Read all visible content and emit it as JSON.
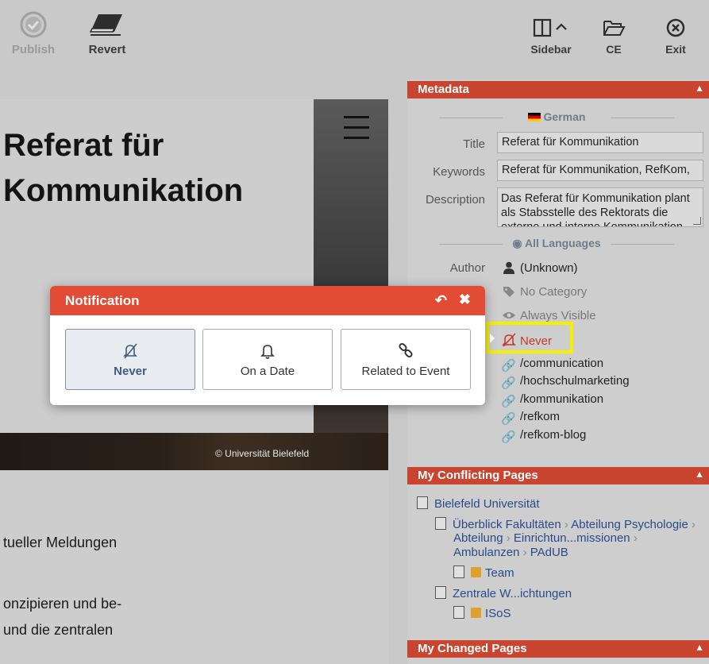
{
  "toolbar": {
    "publish_label": "Publish",
    "revert_label": "Revert",
    "sidebar_label": "Sidebar",
    "ce_label": "CE",
    "exit_label": "Exit"
  },
  "preview": {
    "title_line1": "Referat für",
    "title_line2": "Kommunikation",
    "copyright": "© Universität Bielefeld",
    "text_lines": [
      "tueller Meldungen",
      "onzipieren und be-",
      " und die zentralen"
    ]
  },
  "metadata": {
    "header": "Metadata",
    "language": "German",
    "title_label": "Title",
    "title_value": "Referat für Kommunikation",
    "keywords_label": "Keywords",
    "keywords_value": "Referat für Kommunikation, RefKom,",
    "description_label": "Description",
    "description_value": "Das Referat für Kommunikation plant als Stabsstelle des Rektorats die externe und interne Kommunikation",
    "all_languages": "All Languages",
    "author_label": "Author",
    "author_value": "(Unknown)",
    "category": "No Category",
    "visibility": "Always Visible",
    "notification": "Never",
    "aliases": [
      "/communication",
      "/hochschulmarketing",
      "/kommunikation",
      "/refkom",
      "/refkom-blog"
    ]
  },
  "conflicting": {
    "header": "My Conflicting Pages",
    "root": "Bielefeld Universität",
    "path1": [
      "Überblick Fakultäten",
      "Abteilung Psychologie"
    ],
    "path1_line2": [
      "Abteilung",
      "Einrichtun...missionen"
    ],
    "path1_line3": [
      "Ambulanzen",
      "PAdUB"
    ],
    "leaf1": "Team",
    "path2": "Zentrale W...ichtungen",
    "leaf2": "ISoS"
  },
  "changed": {
    "header": "My Changed Pages"
  },
  "dialog": {
    "title": "Notification",
    "options": [
      "Never",
      "On a Date",
      "Related to Event"
    ]
  },
  "colors": {
    "accent": "#e24c35",
    "section": "#c94530",
    "highlight": "#f4f000"
  }
}
